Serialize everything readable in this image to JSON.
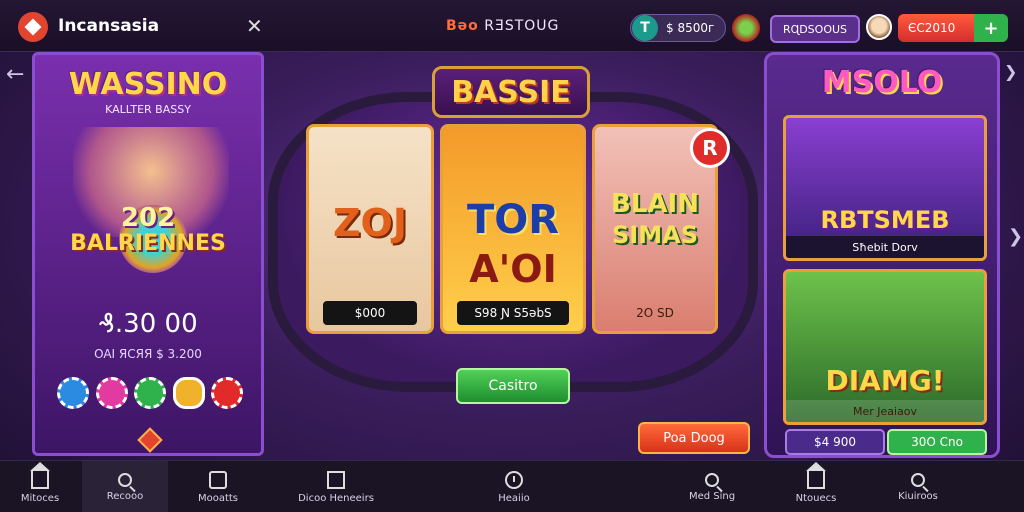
{
  "header": {
    "brand_name": "Incansasia",
    "close_label": "✕",
    "center_accent": "Bǝo",
    "center_title": "RƎSTOUG",
    "coins_icon": "T",
    "coins_value": "$ 8500г",
    "vip_label": "RɊDSOOUS",
    "balance_value": "ЄC2010",
    "add_label": "+"
  },
  "left_promo": {
    "title": "WASSINO",
    "subtitle": "KALLTER BASSY",
    "number": "202",
    "banner": "BALRIENNES",
    "amount": "₰.30 00",
    "note": "OAI ЯCЯЯ $ 3.200"
  },
  "center": {
    "title": "BASSIE",
    "cards": [
      {
        "big": "ZOJ",
        "big2": "",
        "label": "$000"
      },
      {
        "big": "TOR",
        "big2": "A'OI",
        "label": "S98 Ɲ S5ǝbS"
      },
      {
        "big": "BLAIN",
        "big2": "SIMAS",
        "label": "2O SD"
      }
    ],
    "r_badge": "R",
    "play_label": "Casitro",
    "promo_label": "Poa Doog"
  },
  "right_panel": {
    "title": "MSOLO",
    "games": [
      {
        "title": "RBTSMEB",
        "caption": "Sħebit Dorv"
      },
      {
        "title": "DIAMG!",
        "caption": "Mer Jeaiaov"
      }
    ],
    "btn1": "$4 900",
    "btn2": "30O Cno"
  },
  "bottom_nav": {
    "items": [
      {
        "label": "Mitoces",
        "icon": "home-icon"
      },
      {
        "label": "Recooo",
        "icon": "search-icon"
      },
      {
        "label": "Mooatts",
        "icon": "clipboard-icon"
      },
      {
        "label": "Dicoo Heneeirs",
        "icon": "square-icon"
      },
      {
        "label": "Heaiio",
        "icon": "clock-icon"
      },
      {
        "label": "Med Sing",
        "icon": "search-icon"
      },
      {
        "label": "Ntouecs",
        "icon": "home-icon"
      },
      {
        "label": "Kiuiroos",
        "icon": "search-icon"
      }
    ]
  },
  "colors": {
    "accent_purple": "#8a4fd1",
    "gold": "#ffd84a",
    "green": "#2fb24c",
    "red": "#e2452f"
  }
}
